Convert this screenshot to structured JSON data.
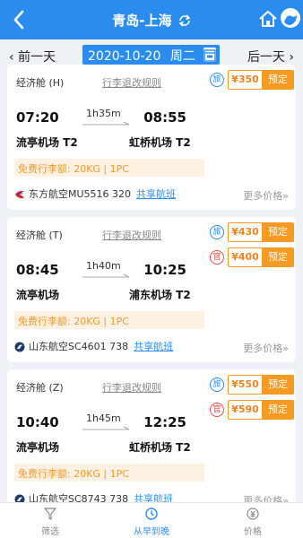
{
  "header": {
    "title": "青岛-上海",
    "back_icon": "back-chevron-icon",
    "swap_icon": "swap-route-icon",
    "home_icon": "home-icon",
    "profile_icon": "profile-icon",
    "color": "#2b8cf0"
  },
  "datebar": {
    "prev_label": "‹ 前一天",
    "next_label": "后一天 ›",
    "date": "2020-10-20",
    "weekday": "周二",
    "calendar_icon": "calendar-icon"
  },
  "flights": [
    {
      "cabin": "经济舱 (H)",
      "rules_label": "行李退改规则",
      "dep_time": "07:20",
      "duration": "1h35m",
      "arr_time": "08:55",
      "dep_airport": "流亭机场 T2",
      "arr_airport": "虹桥机场 T2",
      "baggage": "免费行李额: 20KG | 1PC",
      "airline": "东方航空MU5516 320",
      "share_label": "共享航班",
      "more_label": "更多价格»",
      "prices": [
        {
          "tag": "旅",
          "price": "¥350",
          "book": "预定"
        }
      ]
    },
    {
      "cabin": "经济舱 (T)",
      "rules_label": "行李退改规则",
      "dep_time": "08:45",
      "duration": "1h40m",
      "arr_time": "10:25",
      "dep_airport": "流亭机场",
      "arr_airport": "浦东机场 T2",
      "baggage": "免费行李额: 20KG | 1PC",
      "airline": "山东航空SC4601 738",
      "share_label": "共享航班",
      "more_label": "更多价格»",
      "prices": [
        {
          "tag": "旅",
          "price": "¥430",
          "book": "预定"
        },
        {
          "tag": "官",
          "price": "¥400",
          "book": "预定"
        }
      ]
    },
    {
      "cabin": "经济舱 (Z)",
      "rules_label": "行李退改规则",
      "dep_time": "10:40",
      "duration": "1h45m",
      "arr_time": "12:25",
      "dep_airport": "流亭机场",
      "arr_airport": "虹桥机场 T2",
      "baggage": "免费行李额: 20KG | 1PC",
      "airline": "山东航空SC8743 738",
      "share_label": "共享航班",
      "more_label": "更多价格»",
      "prices": [
        {
          "tag": "旅",
          "price": "¥550",
          "book": "预定"
        },
        {
          "tag": "官",
          "price": "¥590",
          "book": "预定"
        }
      ]
    }
  ],
  "bottom_tabs": [
    {
      "label": "筛选",
      "icon": "filter-icon"
    },
    {
      "label": "从早到晚",
      "icon": "clock-icon"
    },
    {
      "label": "价格",
      "icon": "price-icon"
    }
  ],
  "colors": {
    "accent": "#2b8cf0",
    "price_orange": "#f59a23",
    "baggage_bg": "#fdf1e3"
  }
}
